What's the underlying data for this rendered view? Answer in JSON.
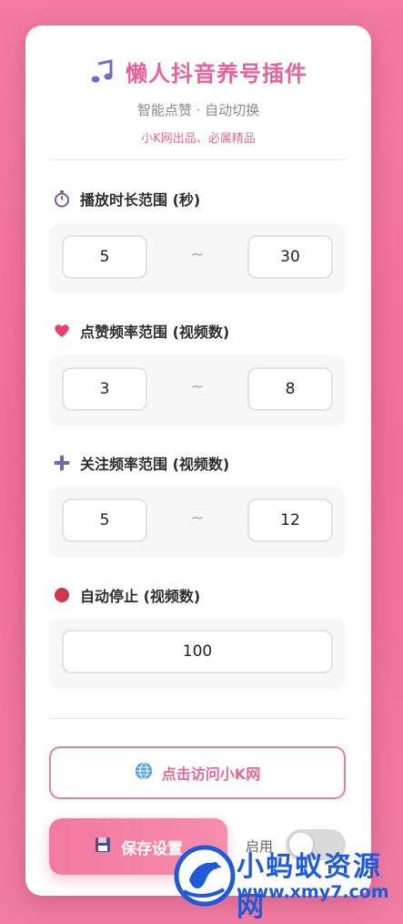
{
  "header": {
    "icon": "music-note-icon",
    "title": "懒人抖音养号插件",
    "subtitle": "智能点赞 · 自动切换",
    "tagline": "小K网出品、必属精品"
  },
  "play_duration": {
    "icon": "stopwatch-icon",
    "label": "播放时长范围 (秒)",
    "min": "5",
    "separator": "~",
    "max": "30"
  },
  "like_frequency": {
    "icon": "heart-icon",
    "label": "点赞频率范围 (视频数)",
    "min": "3",
    "separator": "~",
    "max": "8"
  },
  "follow_frequency": {
    "icon": "plus-icon",
    "label": "关注频率范围 (视频数)",
    "min": "5",
    "separator": "~",
    "max": "12"
  },
  "auto_stop": {
    "icon": "red-circle-icon",
    "label": "自动停止 (视频数)",
    "value": "100"
  },
  "visit_button": {
    "icon": "globe-icon",
    "label": "点击访问小K网"
  },
  "save_button": {
    "icon": "floppy-disk-icon",
    "label": "保存设置"
  },
  "enable": {
    "label": "启用",
    "checked": false
  },
  "watermark": {
    "title": "小蚂蚁资源网",
    "url": "www.xmy7.com"
  },
  "colors": {
    "background": "#ef749e",
    "accent_pink": "#e6639a",
    "heart": "#e8416d",
    "plus": "#7a63b8",
    "stop_dot": "#d0364f",
    "watermark_blue": "#1f5bd8"
  }
}
